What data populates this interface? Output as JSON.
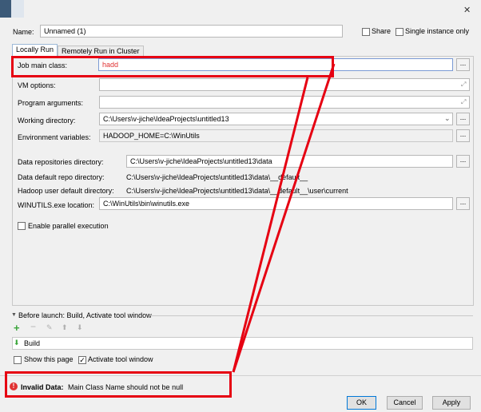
{
  "window": {
    "close_glyph": "✕"
  },
  "name_field": {
    "label": "Name:",
    "value": "Unnamed (1)"
  },
  "share_checkbox": {
    "label": "Share",
    "checked": false
  },
  "single_instance_checkbox": {
    "label": "Single instance only",
    "checked": false
  },
  "tabs": [
    {
      "label": "Locally Run",
      "active": true
    },
    {
      "label": "Remotely Run in Cluster",
      "active": false
    }
  ],
  "form": {
    "job_main_class": {
      "label": "Job main class:",
      "value": "hadd"
    },
    "vm_options": {
      "label": "VM options:",
      "value": ""
    },
    "program_arguments": {
      "label": "Program arguments:",
      "value": ""
    },
    "working_directory": {
      "label": "Working directory:",
      "value": "C:\\Users\\v-jiche\\IdeaProjects\\untitled13"
    },
    "environment_variables": {
      "label": "Environment variables:",
      "value": "HADOOP_HOME=C:\\WinUtils"
    },
    "data_repositories_directory": {
      "label": "Data repositories directory:",
      "value": "C:\\Users\\v-jiche\\IdeaProjects\\untitled13\\data"
    },
    "data_default_repo_directory": {
      "label": "Data default repo directory:",
      "value": "C:\\Users\\v-jiche\\IdeaProjects\\untitled13\\data\\__default__"
    },
    "hadoop_user_default_directory": {
      "label": "Hadoop user default directory:",
      "value": "C:\\Users\\v-jiche\\IdeaProjects\\untitled13\\data\\__default__\\user\\current"
    },
    "winutils_location": {
      "label": "WINUTILS.exe location:",
      "value": "C:\\WinUtils\\bin\\winutils.exe"
    },
    "enable_parallel_execution": {
      "label": "Enable parallel execution",
      "checked": false
    },
    "browse_label": "..."
  },
  "before_launch": {
    "title": "Before launch: Build, Activate tool window",
    "task": "Build",
    "show_this_page": {
      "label": "Show this page",
      "checked": false
    },
    "activate_tool_window": {
      "label": "Activate tool window",
      "checked": true
    }
  },
  "error": {
    "title": "Invalid Data:",
    "message": "Main Class Name should not be null"
  },
  "buttons": {
    "ok": "OK",
    "cancel": "Cancel",
    "apply": "Apply"
  },
  "colors": {
    "annotation_red": "#e60012",
    "error_red": "#e03232",
    "accent_blue": "#0078d7"
  }
}
